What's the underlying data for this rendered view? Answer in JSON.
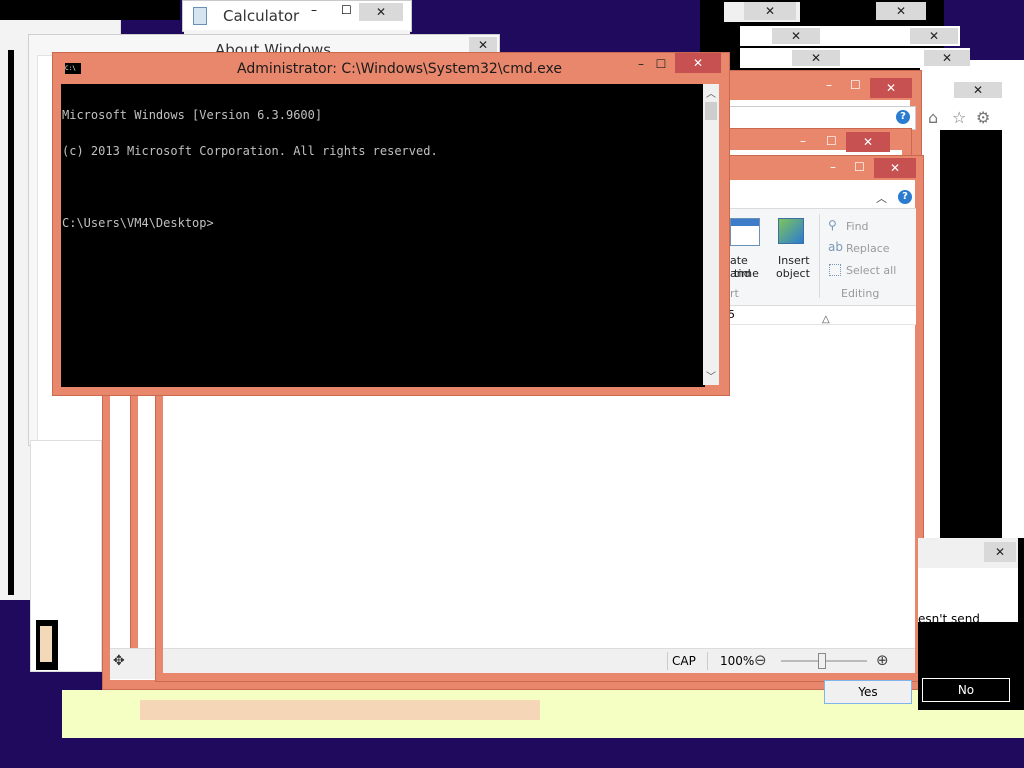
{
  "colors": {
    "desktop": "#1f0a5e",
    "cmd_frame": "#e9876c",
    "close_button": "#c75050"
  },
  "calculator": {
    "title": "Calculator",
    "icon": "calculator-icon"
  },
  "about_windows": {
    "title": "About Windows"
  },
  "cmd": {
    "title": "Administrator: C:\\Windows\\System32\\cmd.exe",
    "icon_label": "C:\\",
    "lines": [
      "Microsoft Windows [Version 6.3.9600]",
      "(c) 2013 Microsoft Corporation. All rights reserved.",
      "",
      "C:\\Users\\VM4\\Desktop>"
    ]
  },
  "caption_glyphs": {
    "minimize": "–",
    "maximize": "☐",
    "close": "✕",
    "help": "?"
  },
  "wordpad": {
    "ribbon": {
      "date_time_label": [
        "ate and",
        "time"
      ],
      "insert_object_label": [
        "Insert",
        "object"
      ],
      "find": "Find",
      "replace": "Replace",
      "select_all": "Select all",
      "editing_group": "Editing",
      "insert_group_fragment": "rt",
      "ruler_fragment": "5"
    },
    "status": {
      "cap": "CAP",
      "zoom": "100%",
      "minus": "⊖",
      "plus": "⊕"
    }
  },
  "dialog": {
    "text_fragment": "esn't send",
    "yes": "Yes",
    "no": "No"
  }
}
